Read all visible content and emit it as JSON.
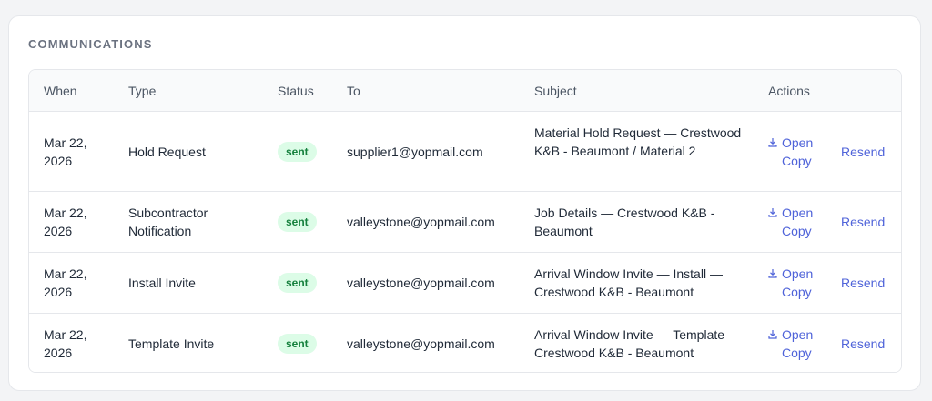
{
  "section": {
    "title": "COMMUNICATIONS"
  },
  "table": {
    "columns": {
      "when": "When",
      "type": "Type",
      "status": "Status",
      "to": "To",
      "subject": "Subject",
      "actions": "Actions"
    },
    "rows": [
      {
        "when": "Mar 22, 2026",
        "type": "Hold Request",
        "status": "sent",
        "to": "supplier1@yopmail.com",
        "subject": "Material Hold Request — Crestwood K&B - Beaumont / Material 2",
        "open_copy": "Open Copy",
        "resend": "Resend"
      },
      {
        "when": "Mar 22, 2026",
        "type": "Subcontractor Notification",
        "status": "sent",
        "to": "valleystone@yopmail.com",
        "subject": "Job Details — Crestwood K&B - Beaumont",
        "open_copy": "Open Copy",
        "resend": "Resend"
      },
      {
        "when": "Mar 22, 2026",
        "type": "Install Invite",
        "status": "sent",
        "to": "valleystone@yopmail.com",
        "subject": "Arrival Window Invite — Install — Crestwood K&B - Beaumont",
        "open_copy": "Open Copy",
        "resend": "Resend"
      },
      {
        "when": "Mar 22, 2026",
        "type": "Template Invite",
        "status": "sent",
        "to": "valleystone@yopmail.com",
        "subject": "Arrival Window Invite — Template — Crestwood K&B - Beaumont",
        "open_copy": "Open Copy",
        "resend": "Resend"
      }
    ]
  },
  "icons": {
    "open_copy": "download-icon"
  },
  "colors": {
    "link": "#4f63d9",
    "badge_bg": "#dcfce7",
    "badge_text": "#15803d"
  }
}
